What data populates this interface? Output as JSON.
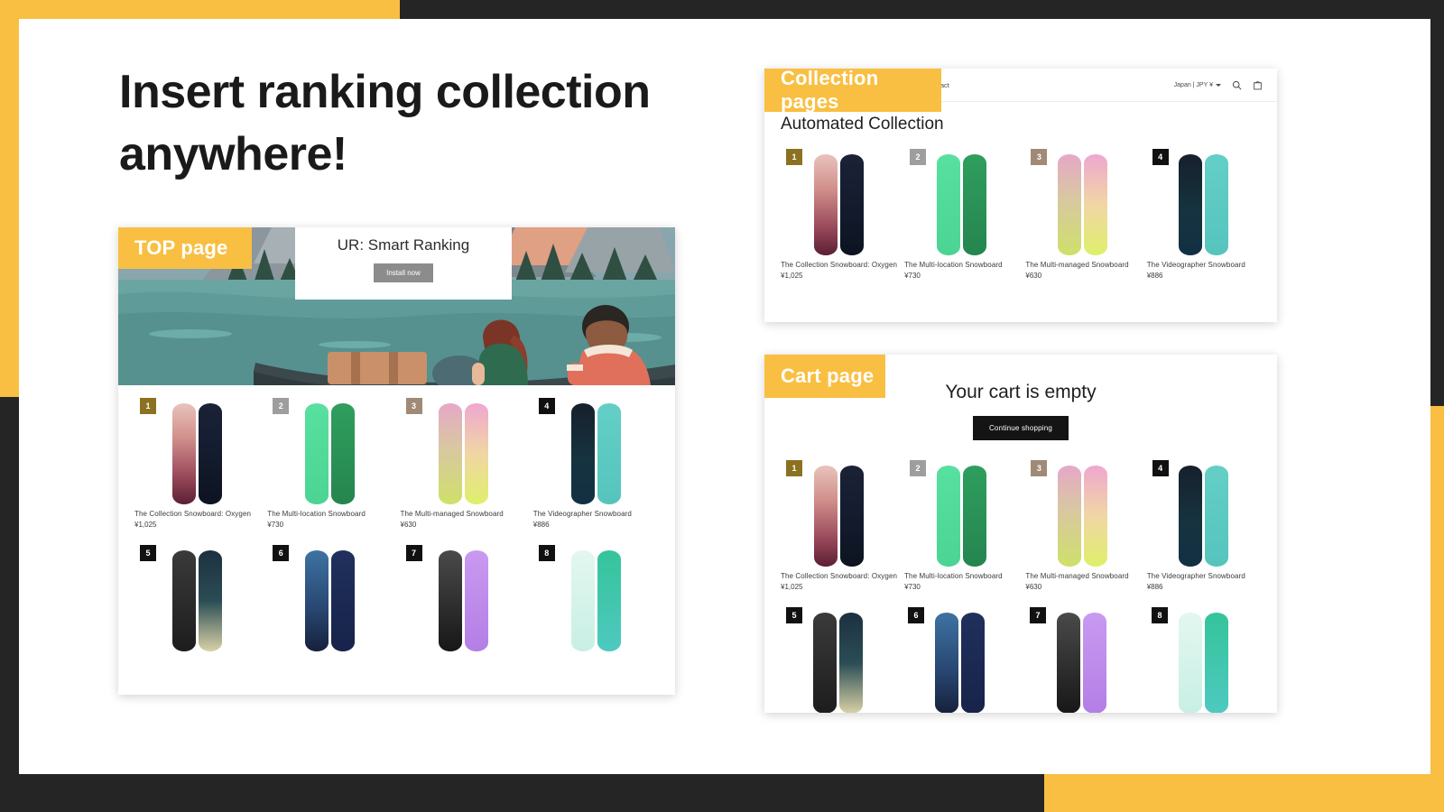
{
  "headline": "Insert ranking collection anywhere!",
  "colors": {
    "accent_yellow": "#F9BF42",
    "dark": "#252525",
    "badge_gold": "#8A7222",
    "badge_silver": "#9E9E9E",
    "badge_bronze": "#A08A77",
    "badge_black": "#111111",
    "button_black": "#141414",
    "install_button_gray": "#8C8C8C"
  },
  "tags": {
    "top_page": "TOP page",
    "collection_pages": "Collection pages",
    "cart_page": "Cart page"
  },
  "top_panel": {
    "hero_card": {
      "title": "UR: Smart Ranking",
      "install_label": "Install now"
    }
  },
  "collection_panel": {
    "header": {
      "nav": [
        "Contact"
      ],
      "currency": "Japan | JPY ¥",
      "chevron_icon": "chevron-down-icon",
      "search_icon": "search-icon",
      "cart_icon": "cart-icon"
    },
    "title": "Automated Collection"
  },
  "cart_panel": {
    "empty_title": "Your cart is empty",
    "continue_label": "Continue shopping"
  },
  "products": [
    {
      "rank": "1",
      "name": "The Collection Snowboard: Oxygen",
      "price": "¥1,025",
      "badge": "b1",
      "left": "linear-gradient(180deg,#e9c3bd 0%,#d08e8a 35%,#9d4d5e 70%,#5c1f33 100%)",
      "right": "linear-gradient(180deg,#1b2236 0%,#121a2c 60%,#0d1320 100%)"
    },
    {
      "rank": "2",
      "name": "The Multi-location Snowboard",
      "price": "¥730",
      "badge": "b2",
      "left": "linear-gradient(180deg,#58e0a0 0%,#4bd493 100%)",
      "right": "linear-gradient(180deg,#2f9e5e 0%,#25854e 100%)"
    },
    {
      "rank": "3",
      "name": "The Multi-managed Snowboard",
      "price": "¥630",
      "badge": "b3",
      "left": "linear-gradient(180deg,#e6a8c8 0%,#d8c8a0 45%,#cfe06a 100%)",
      "right": "linear-gradient(180deg,#efa7cf 0%,#f0d6a4 50%,#dff06a 100%)"
    },
    {
      "rank": "4",
      "name": "The Videographer Snowboard",
      "price": "¥886",
      "badge": "bk",
      "left": "linear-gradient(180deg,#16202c 0%,#16333f 55%,#123043 100%)",
      "right": "linear-gradient(180deg,#63cfc6 0%,#56c4bd 100%)"
    },
    {
      "rank": "5",
      "name": "",
      "price": "",
      "badge": "bk",
      "left": "linear-gradient(180deg,#3a3a3a 0%,#1d1d1d 100%)",
      "right": "linear-gradient(180deg,#1d3040 0%,#2b4d55 50%,#d9d2a6 100%)"
    },
    {
      "rank": "6",
      "name": "",
      "price": "",
      "badge": "bk",
      "left": "linear-gradient(180deg,#3e72a3 0%,#27456f 60%,#16213c 100%)",
      "right": "linear-gradient(180deg,#20305c 0%,#17234a 100%)"
    },
    {
      "rank": "7",
      "name": "",
      "price": "",
      "badge": "bk",
      "left": "linear-gradient(180deg,#4a4a4a 0%,#171717 100%)",
      "right": "linear-gradient(180deg,#c89af0 0%,#b47ee6 100%)"
    },
    {
      "rank": "8",
      "name": "",
      "price": "",
      "badge": "bk",
      "left": "linear-gradient(180deg,#e3f7f0 0%,#c8efe4 100%)",
      "right": "linear-gradient(180deg,#35c49a 0%,#4ec9c0 100%)"
    }
  ]
}
